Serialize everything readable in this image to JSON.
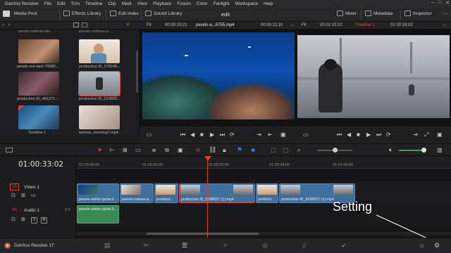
{
  "menu": {
    "app_name": "DaVinci Resolve",
    "items": [
      "File",
      "Edit",
      "Trim",
      "Timeline",
      "Clip",
      "Mark",
      "View",
      "Playback",
      "Fusion",
      "Color",
      "Fairlight",
      "Workspace",
      "Help"
    ]
  },
  "toolbar": {
    "media_pool": "Media Pool",
    "effects_library": "Effects Library",
    "edit_index": "Edit Index",
    "sound_library": "Sound Library",
    "project_title": "edit",
    "mixer": "Mixer",
    "metadata": "Metadata",
    "inspector": "Inspector"
  },
  "source_viewer": {
    "fit": "Fit",
    "timecode_left": "00:00:10:21",
    "clip_name": "pexels-a...8755.mp4",
    "timecode_right": "00:00:11:10"
  },
  "timeline_viewer": {
    "fit": "Fit",
    "timecode_left": "00:01:10:10",
    "timeline_name": "Timeline 1",
    "timecode_right": "01:00:33:02"
  },
  "media_pool": {
    "header_labels": [
      "pexels-mikhail-nilo...",
      "pexels-coldnee-p..."
    ],
    "clips": [
      {
        "label": "pexels-ron-lach-79580...",
        "color": "#8a6a5a"
      },
      {
        "label": "production ID_378148...",
        "color": "#d8c8b8"
      },
      {
        "label": "production ID_481271...",
        "color": "#7a4a5a"
      },
      {
        "label": "production ID_519890...",
        "color": "#9aa0a8"
      },
      {
        "label": "Timeline 1",
        "color": "#2a5a8a"
      },
      {
        "label": "woman_morning7.mp4",
        "color": "#b8a898"
      }
    ]
  },
  "timeline": {
    "timecode": "01:00:33:02",
    "ruler_ticks": [
      "01:00:00:00",
      "01:00:16:00",
      "01:00:32:00",
      "01:00:48:00",
      "01:01:04:00"
    ],
    "video_track": {
      "id": "V1",
      "name": "Video 1"
    },
    "audio_track": {
      "id": "A1",
      "name": "Audio 1",
      "level": "2.0"
    },
    "video_clips": [
      {
        "label": "pexels-adrien-jacta-5...",
        "color": "#3e6e9c"
      },
      {
        "label": "pexels-rodnae-p...",
        "color": "#3e6e9c"
      },
      {
        "label": "producti...",
        "color": "#3e6e9c"
      },
      {
        "label": "production ID_5198937 (1).mp4",
        "color": "#3e6e9c"
      },
      {
        "label": "producti...",
        "color": "#3e6e9c"
      },
      {
        "label": "production ID_5198937 (1).mp4",
        "color": "#3e6e9c"
      }
    ],
    "audio_clips": [
      {
        "label": "pexels-adrien-jacta-5...",
        "color": "#3a8a56"
      }
    ]
  },
  "annotation": {
    "text": "Setting"
  },
  "statusbar": {
    "app_label": "DaVinci Resolve 17"
  },
  "colors": {
    "accent_red": "#e0413a",
    "playhead": "#e53935",
    "clip_blue": "#3e6e9c",
    "clip_green": "#3a8a56"
  }
}
